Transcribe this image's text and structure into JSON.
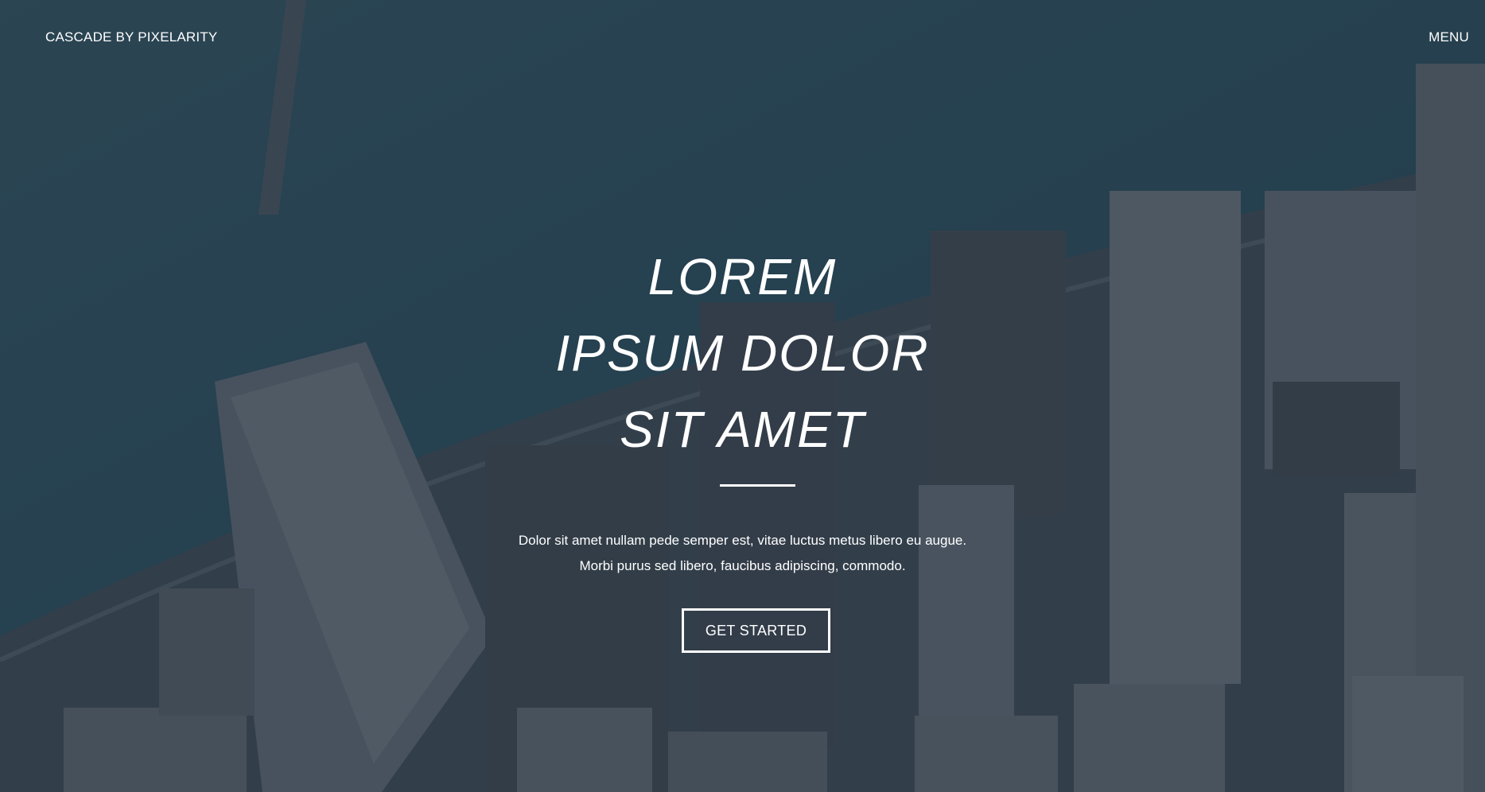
{
  "header": {
    "brand": "CASCADE BY PIXELARITY",
    "menu_label": "MENU"
  },
  "hero": {
    "title_lines": [
      "LOREM",
      "IPSUM DOLOR",
      "SIT AMET"
    ],
    "description_lines": [
      "Dolor sit amet nullam pede semper est, vitae luctus metus libero eu augue.",
      "Morbi purus sed libero, faucibus adipiscing, commodo."
    ],
    "cta_label": "GET STARTED"
  },
  "colors": {
    "overlay": "#2c3a47",
    "water": "#1f4a5e",
    "text": "#ffffff"
  }
}
